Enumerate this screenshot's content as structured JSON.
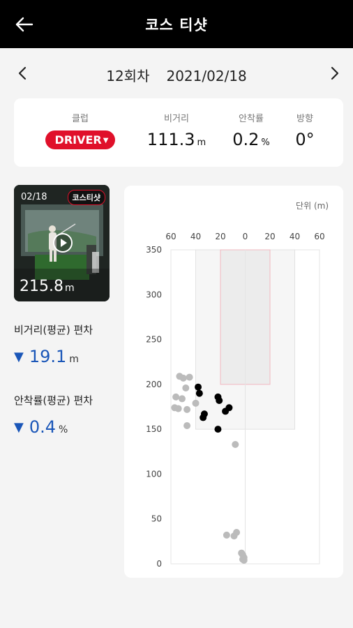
{
  "header": {
    "title": "코스 티샷"
  },
  "session": {
    "round": "12회차",
    "date": "2021/02/18"
  },
  "stats": {
    "club": {
      "label": "클럽",
      "value": "DRIVER"
    },
    "carry": {
      "label": "비거리",
      "value": "111.3",
      "unit": "m"
    },
    "accuracy": {
      "label": "안착률",
      "value": "0.2",
      "unit": "%"
    },
    "direction": {
      "label": "방향",
      "value": "0°"
    }
  },
  "video": {
    "date": "02/18",
    "tag": "코스티샷",
    "distance": "215.8",
    "unit": "m"
  },
  "deviation": {
    "carry": {
      "label": "비거리(평균) 편차",
      "value": "19.1",
      "unit": "m",
      "direction": "down"
    },
    "accuracy": {
      "label": "안착률(평균) 편차",
      "value": "0.4",
      "unit": "%",
      "direction": "down"
    }
  },
  "colors": {
    "accent": "#e0102a",
    "deviation": "#1a56b8",
    "recent_shot": "#000000",
    "past_shot": "#bbbbbb"
  },
  "chart_data": {
    "type": "scatter",
    "unit_label": "단위 (m)",
    "x_ticks": [
      "60",
      "40",
      "20",
      "0",
      "20",
      "40",
      "60"
    ],
    "y_ticks": [
      "0",
      "50",
      "100",
      "150",
      "200",
      "250",
      "300",
      "350"
    ],
    "xlim": [
      -60,
      60
    ],
    "ylim": [
      0,
      350
    ],
    "fairway": {
      "x_range": [
        -40,
        40
      ],
      "y_range": [
        150,
        350
      ]
    },
    "target": {
      "x_range": [
        -20,
        20
      ],
      "y_range": [
        200,
        350
      ]
    },
    "series": [
      {
        "kind": "recent",
        "color": "#000000",
        "points": [
          [
            -38,
            197
          ],
          [
            -37,
            190
          ],
          [
            -33,
            167
          ],
          [
            -34,
            163
          ],
          [
            -22,
            186
          ],
          [
            -21,
            182
          ],
          [
            -16,
            170
          ],
          [
            -13,
            174
          ],
          [
            -22,
            150
          ]
        ]
      },
      {
        "kind": "past",
        "color": "#bbbbbb",
        "points": [
          [
            -53,
            209
          ],
          [
            -50,
            207
          ],
          [
            -45,
            208
          ],
          [
            -48,
            196
          ],
          [
            -56,
            186
          ],
          [
            -51,
            184
          ],
          [
            -57,
            174
          ],
          [
            -54,
            173
          ],
          [
            -47,
            172
          ],
          [
            -40,
            179
          ],
          [
            -47,
            154
          ],
          [
            -8,
            133
          ],
          [
            -15,
            32
          ],
          [
            -9,
            31
          ],
          [
            -7,
            35
          ],
          [
            -3,
            12
          ],
          [
            -2,
            10
          ],
          [
            -1,
            7
          ],
          [
            -2,
            5
          ],
          [
            -1,
            4
          ]
        ]
      }
    ]
  }
}
